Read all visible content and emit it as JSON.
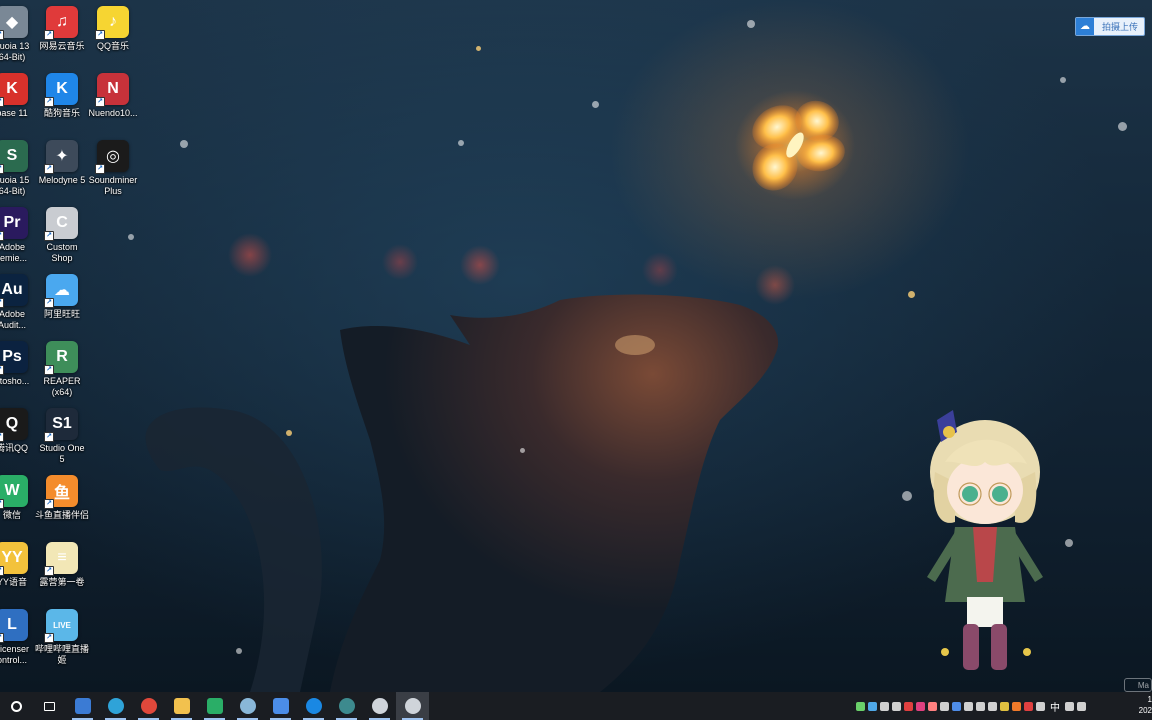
{
  "desktop": {
    "column1": [
      {
        "label": "quoia 13\n64-Bit)",
        "icon": "sequoia-icon",
        "color": "#7a8896",
        "glyph": "◆"
      },
      {
        "label": "base 11",
        "icon": "cubase-icon",
        "color": "#d8312b",
        "glyph": "K"
      },
      {
        "label": "quoia 15\n64-Bit)",
        "icon": "sequoia-15-icon",
        "color": "#2b6b4f",
        "glyph": "S"
      },
      {
        "label": "Adobe\nremie...",
        "icon": "premiere-icon",
        "color": "#2a1a5e",
        "glyph": "Pr"
      },
      {
        "label": "Adobe\nAudit...",
        "icon": "audition-icon",
        "color": "#0b2340",
        "glyph": "Au"
      },
      {
        "label": "otosho...",
        "icon": "photoshop-icon",
        "color": "#0b2240",
        "glyph": "Ps"
      },
      {
        "label": "腾讯QQ",
        "icon": "qq-icon",
        "color": "#1a1a1a",
        "glyph": "Q"
      },
      {
        "label": "微信",
        "icon": "wechat-icon",
        "color": "#2aae67",
        "glyph": "W"
      },
      {
        "label": "YY语音",
        "icon": "yy-icon",
        "color": "#f3c23c",
        "glyph": "YY"
      },
      {
        "label": "Licenser\nontrol...",
        "icon": "license-control-icon",
        "color": "#2f6fc1",
        "glyph": "L"
      }
    ],
    "column2": [
      {
        "label": "网易云音乐",
        "icon": "netease-music-icon",
        "color": "#e03a3a",
        "glyph": "♫"
      },
      {
        "label": "酷狗音乐",
        "icon": "kugou-icon",
        "color": "#1f86e8",
        "glyph": "K"
      },
      {
        "label": "Melodyne 5",
        "icon": "melodyne-icon",
        "color": "#3d4a5a",
        "glyph": "✦"
      },
      {
        "label": "Custom\nShop",
        "icon": "custom-shop-icon",
        "color": "#c9ccd1",
        "glyph": "C"
      },
      {
        "label": "阿里旺旺",
        "icon": "aliwangwang-icon",
        "color": "#4aa8ef",
        "glyph": "☁"
      },
      {
        "label": "REAPER\n(x64)",
        "icon": "reaper-icon",
        "color": "#3e8e5a",
        "glyph": "R"
      },
      {
        "label": "Studio One\n5",
        "icon": "studio-one-icon",
        "color": "#1e2a3a",
        "glyph": "S1"
      },
      {
        "label": "斗鱼直播伴侣",
        "icon": "douyu-icon",
        "color": "#f48c2c",
        "glyph": "鱼"
      },
      {
        "label": "露营第一卷",
        "icon": "document-icon",
        "color": "#f2e7b6",
        "glyph": "≡"
      },
      {
        "label": "哔哩哔哩直播\n姬",
        "icon": "bilibili-live-icon",
        "color": "#5bb7e8",
        "glyph": "LIVE"
      }
    ],
    "column3": [
      {
        "label": "QQ音乐",
        "icon": "qq-music-icon",
        "color": "#f6d532",
        "glyph": "♪"
      },
      {
        "label": "Nuendo10...",
        "icon": "nuendo-icon",
        "color": "#c7323a",
        "glyph": "N"
      },
      {
        "label": "Soundminer\nPlus",
        "icon": "soundminer-icon",
        "color": "#1b1b1b",
        "glyph": "◎"
      }
    ]
  },
  "upload_button": {
    "label": "拍摄上传"
  },
  "taskbar": {
    "apps": [
      {
        "name": "start-button",
        "icon": "start-icon",
        "color": "#ffffff"
      },
      {
        "name": "task-view-button",
        "icon": "task-view-icon",
        "color": "#ffffff"
      },
      {
        "name": "taskbar-app-1",
        "icon": "store-icon",
        "color": "#3b7bd4"
      },
      {
        "name": "taskbar-edge",
        "icon": "edge-icon",
        "color": "#2fa3d8"
      },
      {
        "name": "taskbar-chrome",
        "icon": "chrome-icon",
        "color": "#e0483b"
      },
      {
        "name": "taskbar-explorer",
        "icon": "folder-icon",
        "color": "#f2c14e"
      },
      {
        "name": "taskbar-wechat",
        "icon": "wechat-icon",
        "color": "#2aae67"
      },
      {
        "name": "taskbar-app-2",
        "icon": "app-icon",
        "color": "#89b7d8"
      },
      {
        "name": "taskbar-baidu-netdisk",
        "icon": "cloud-icon",
        "color": "#4b8de8"
      },
      {
        "name": "taskbar-app-3",
        "icon": "app-icon",
        "color": "#1a88e3"
      },
      {
        "name": "taskbar-app-4",
        "icon": "app-icon",
        "color": "#3d8a8e"
      },
      {
        "name": "taskbar-app-5",
        "icon": "app-icon",
        "color": "#cfd4da"
      },
      {
        "name": "taskbar-obs",
        "icon": "obs-icon",
        "color": "#cfd4da"
      }
    ],
    "tray_icons": [
      "#6ad06a",
      "#4fa8e8",
      "#d0d0d0",
      "#d0d0d0",
      "#e04040",
      "#e04080",
      "#ff8080",
      "#d0d0d0",
      "#4f8de8",
      "#d0d0d0",
      "#d0d0d0",
      "#d0d0d0",
      "#e0c040",
      "#f07a2a",
      "#e04040",
      "#d0d0d0",
      "#d0d0d0",
      "#d0d0d0"
    ],
    "ime": "中",
    "clock_time": "1",
    "clock_date": "202"
  },
  "watermark": "Ma"
}
